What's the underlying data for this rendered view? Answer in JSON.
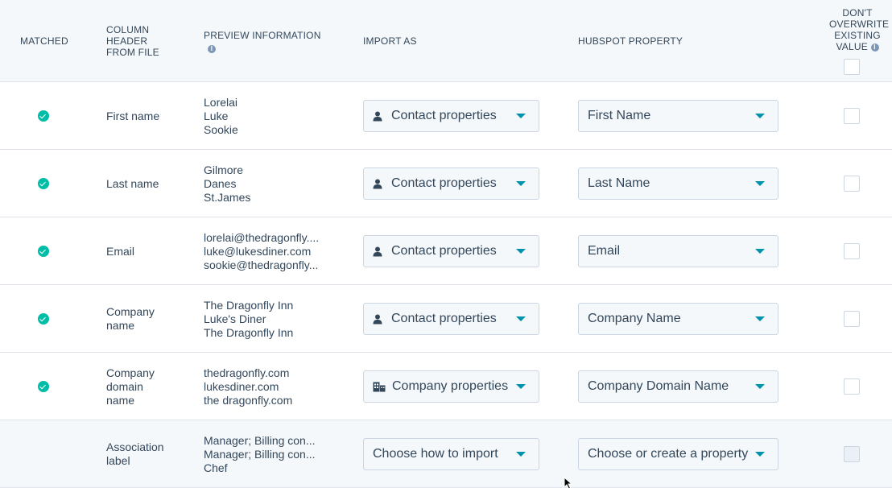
{
  "headers": {
    "matched": "MATCHED",
    "column_header": [
      "COLUMN",
      "HEADER",
      "FROM FILE"
    ],
    "preview": "PREVIEW INFORMATION",
    "import_as": "IMPORT AS",
    "hubspot_property": "HUBSPOT PROPERTY",
    "dont_overwrite": [
      "DON'T",
      "OVERWRITE",
      "EXISTING",
      "VALUE"
    ]
  },
  "rows": [
    {
      "matched": true,
      "column": [
        "First name"
      ],
      "preview": [
        "Lorelai",
        "Luke",
        "Sookie"
      ],
      "import_as": "Contact properties",
      "import_icon": "person-icon",
      "property": "First Name"
    },
    {
      "matched": true,
      "column": [
        "Last name"
      ],
      "preview": [
        "Gilmore",
        "Danes",
        "St.James"
      ],
      "import_as": "Contact properties",
      "import_icon": "person-icon",
      "property": "Last Name"
    },
    {
      "matched": true,
      "column": [
        "Email"
      ],
      "preview": [
        "lorelai@thedragonfly....",
        "luke@lukesdiner.com",
        "sookie@thedragonfly..."
      ],
      "import_as": "Contact properties",
      "import_icon": "person-icon",
      "property": "Email"
    },
    {
      "matched": true,
      "column": [
        "Company",
        "name"
      ],
      "preview": [
        "The Dragonfly Inn",
        "Luke's Diner",
        "The Dragonfly Inn"
      ],
      "import_as": "Contact properties",
      "import_icon": "person-icon",
      "property": "Company Name"
    },
    {
      "matched": true,
      "column": [
        "Company",
        "domain",
        "name"
      ],
      "preview": [
        "thedragonfly.com",
        "lukesdiner.com",
        "the dragonfly.com"
      ],
      "import_as": "Company properties",
      "import_icon": "building-icon",
      "property": "Company Domain Name"
    },
    {
      "matched": false,
      "column": [
        "Association",
        "label"
      ],
      "preview": [
        "Manager; Billing con...",
        "Manager; Billing con...",
        "Chef"
      ],
      "import_as": "Choose how to import",
      "import_icon": "",
      "property": "Choose or create a property"
    }
  ],
  "colors": {
    "accent": "#0091ae",
    "matched": "#00bda5",
    "header_bg": "#f5f8fa",
    "text": "#33475b"
  }
}
